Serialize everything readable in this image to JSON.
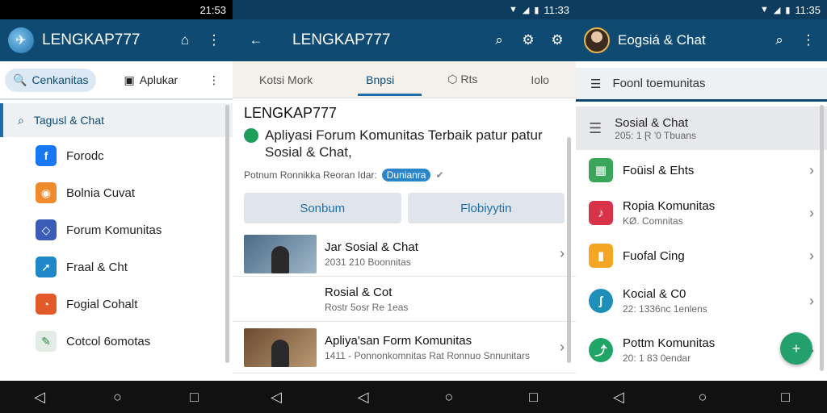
{
  "left": {
    "status_time": "21:53",
    "app_title": "LENGKAP777",
    "tabs": [
      {
        "label": "Cenkanitas"
      },
      {
        "label": "Aplukar"
      }
    ],
    "search_label": "Tagusl & Chat",
    "items": [
      {
        "label": "Forodc",
        "icon": "facebook-icon",
        "color": "#1877f2",
        "glyph": "f"
      },
      {
        "label": "Bolnia Cuvat",
        "icon": "chat-icon",
        "color": "#ef8b2c",
        "glyph": "◉"
      },
      {
        "label": "Forum Komunitas",
        "icon": "forum-icon",
        "color": "#3b5db8",
        "glyph": "◇"
      },
      {
        "label": "Fraal & Cht",
        "icon": "send-icon",
        "color": "#1e88c8",
        "glyph": "➚"
      },
      {
        "label": "Fogial Cohalt",
        "icon": "social-icon",
        "color": "#e25a2a",
        "glyph": "◔"
      },
      {
        "label": "Cotcol 6omotas",
        "icon": "pen-icon",
        "color": "#e4ece6",
        "glyph": "✎"
      }
    ]
  },
  "middle": {
    "status_time": "11:33",
    "app_title": "LENGKAP777",
    "tabs": [
      {
        "label": "Kotsi Mork"
      },
      {
        "label": "Bnpsi"
      },
      {
        "label": "Rts"
      },
      {
        "label": "Iolo"
      }
    ],
    "hero_title": "LENGKAP777",
    "hero_desc": "Apliyasi Forum Komunitas Terbaik patur patur Sosial & Chat,",
    "hero_meta": "Potnum Ronnikka Reoran Idar:",
    "hero_badge": "Dunianra",
    "buttons": [
      "Sonbum",
      "Flobiyytin"
    ],
    "list": [
      {
        "title": "Jar Sosial & Chat",
        "sub": "2031 210   Boonnitas"
      },
      {
        "title": "Rosial & Cot",
        "sub": "Rostr 5osr  Re 1eas"
      },
      {
        "title": "Apliya'san Form Komunitas",
        "sub": "1411 - Ponnonkomnitas  Rat  Ronnuo Snnunitars"
      }
    ]
  },
  "right": {
    "status_time": "11:35",
    "app_title": "Eogsiá & Chat",
    "search_label": "Foonl toemunitas",
    "selected": {
      "title": "Sosial & Chat",
      "sub": "205: 1 Ɽ '0 Tbuans"
    },
    "items": [
      {
        "title": "Foüisl & Ehts",
        "sub": "",
        "color": "#3aa65a",
        "glyph": "▦"
      },
      {
        "title": "Ropia Komunitas",
        "sub": "KØ. Comnitas",
        "color": "#d9334a",
        "glyph": "♪"
      },
      {
        "title": "Fuofal Cing",
        "sub": "",
        "color": "#f2a623",
        "glyph": "▮"
      },
      {
        "title": "Kocial & C0",
        "sub": "22: 1336nc 1enlens",
        "color": "#1e8fb8",
        "glyph": "ʃ"
      },
      {
        "title": "Pottm Komunitas",
        "sub": "20: 1 83 0endar",
        "color": "#1fa566",
        "glyph": "⤴"
      }
    ]
  }
}
